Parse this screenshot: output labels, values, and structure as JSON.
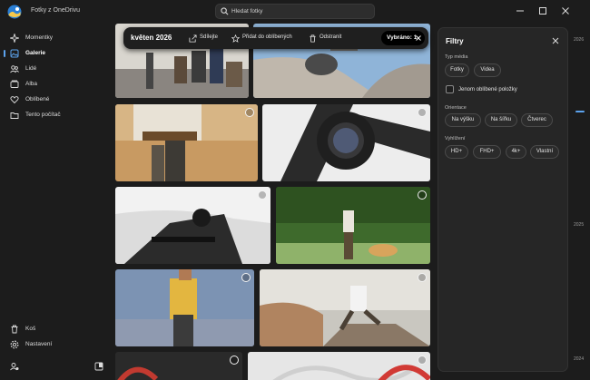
{
  "app": {
    "title": "Fotky z OneDrivu"
  },
  "search": {
    "placeholder": "Hledat fotky"
  },
  "sidebar": {
    "items": [
      {
        "label": "Momentky",
        "icon": "sparkle-icon"
      },
      {
        "label": "Galerie",
        "icon": "gallery-icon",
        "active": true
      },
      {
        "label": "Lidé",
        "icon": "people-icon"
      },
      {
        "label": "Alba",
        "icon": "album-icon"
      },
      {
        "label": "Oblíbené",
        "icon": "heart-icon"
      },
      {
        "label": "Tento počítač",
        "icon": "folder-icon"
      }
    ],
    "bottom_items": [
      {
        "label": "Koš",
        "icon": "trash-icon"
      },
      {
        "label": "Nastavení",
        "icon": "gear-icon"
      }
    ]
  },
  "commandbar": {
    "date_heading": "květen 2026",
    "share_label": "Sdílejte",
    "favorite_label": "Přidat do oblíbených",
    "delete_label": "Odstranit",
    "selected_label": "Vybráno: 1"
  },
  "filters": {
    "title": "Filtry",
    "media_type": {
      "label": "Typ média",
      "options": [
        "Fotky",
        "Videa"
      ]
    },
    "favorites_only_label": "Jenom oblíbené položky",
    "orientation": {
      "label": "Orientace",
      "options": [
        "Na výšku",
        "Na šířku",
        "Čtverec"
      ]
    },
    "resolution": {
      "label": "Vyhlížení",
      "options": [
        "HD+",
        "FHD+",
        "4k+",
        "Vlastní"
      ]
    }
  },
  "timeline": {
    "years": [
      "2026",
      "2025",
      "2024"
    ]
  },
  "colors": {
    "accent": "#5ca3ee",
    "background": "#1c1c1c",
    "panel": "#262626"
  }
}
